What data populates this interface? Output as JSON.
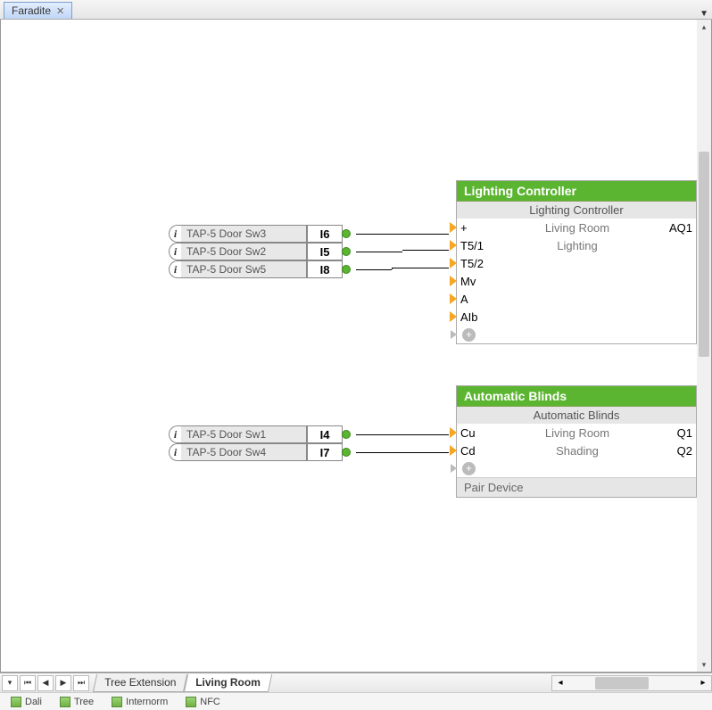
{
  "tab_label": "Faradite",
  "block1": {
    "title": "Lighting Controller",
    "subtitle": "Lighting Controller",
    "mid1": "Living Room",
    "mid2": "Lighting",
    "out1": "AQ1",
    "inputs": [
      "+",
      "T5/1",
      "T5/2",
      "Mv",
      "A",
      "AIb"
    ]
  },
  "block2": {
    "title": "Automatic Blinds",
    "subtitle": "Automatic Blinds",
    "mid1": "Living Room",
    "mid2": "Shading",
    "out1": "Q1",
    "out2": "Q2",
    "inputs": [
      "Cu",
      "Cd"
    ],
    "footer": "Pair Device"
  },
  "tags1": [
    {
      "label": "TAP-5 Door Sw3",
      "io": "I6"
    },
    {
      "label": "TAP-5 Door Sw2",
      "io": "I5"
    },
    {
      "label": "TAP-5 Door Sw5",
      "io": "I8"
    }
  ],
  "tags2": [
    {
      "label": "TAP-5 Door Sw1",
      "io": "I4"
    },
    {
      "label": "TAP-5 Door Sw4",
      "io": "I7"
    }
  ],
  "sheets": [
    "Tree Extension",
    "Living Room"
  ],
  "bottom_items": [
    "Dali",
    "Tree",
    "Internorm",
    "NFC"
  ]
}
